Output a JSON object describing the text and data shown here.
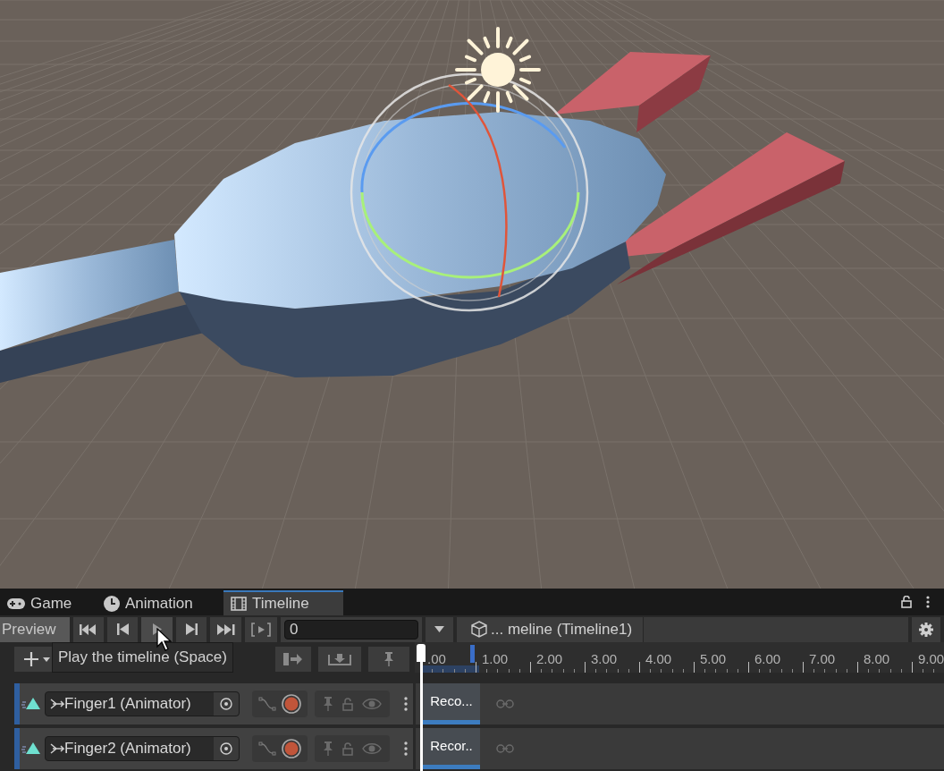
{
  "tabs": [
    {
      "kind": "game",
      "label": "Game",
      "selected": false
    },
    {
      "kind": "animation",
      "label": "Animation",
      "selected": false
    },
    {
      "kind": "timeline",
      "label": "Timeline",
      "selected": true
    }
  ],
  "toolbar": {
    "preview_label": "Preview",
    "frame_field": "0",
    "breadcrumb": "... meline (Timeline1)"
  },
  "tooltip": "Play the timeline (Space)",
  "ruler": [
    ".00",
    "1.00",
    "2.00",
    "3.00",
    "4.00",
    "5.00",
    "6.00",
    "7.00",
    "8.00",
    "9.00"
  ],
  "tracks": [
    {
      "name": "Finger1 (Animator)",
      "clip": "Reco..."
    },
    {
      "name": "Finger2 (Animator)",
      "clip": "Recor.."
    }
  ]
}
